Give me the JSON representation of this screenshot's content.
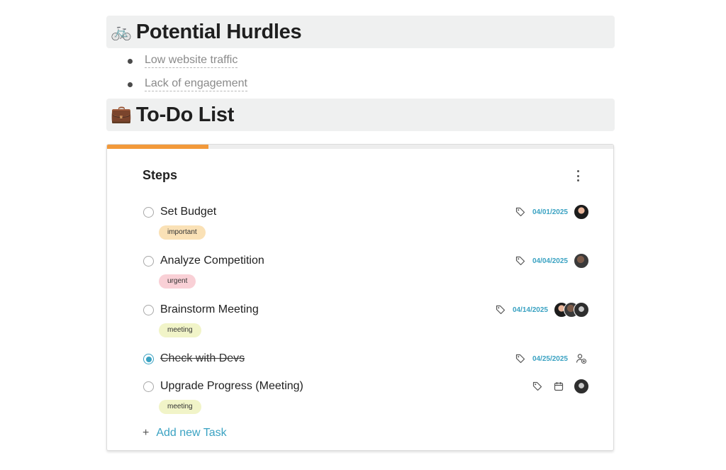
{
  "sections": {
    "hurdles": {
      "emoji": "🚲",
      "title": "Potential Hurdles"
    },
    "todo": {
      "emoji": "💼",
      "title": "To-Do List"
    }
  },
  "bullets": [
    "Low website traffic",
    "Lack of engagement"
  ],
  "card": {
    "title": "Steps",
    "progress": 0.2,
    "colors": {
      "progress": "#f2993a",
      "accent": "#3aa2c2"
    },
    "tasks": [
      {
        "name": "Set Budget",
        "tag": "important",
        "date": "04/01/2025",
        "done": false,
        "assignees": 1
      },
      {
        "name": "Analyze Competition",
        "tag": "urgent",
        "date": "04/04/2025",
        "done": false,
        "assignees": 1
      },
      {
        "name": "Brainstorm Meeting",
        "tag": "meeting",
        "date": "04/14/2025",
        "done": false,
        "assignees": 3
      },
      {
        "name": "Check with Devs",
        "tag": "",
        "date": "04/25/2025",
        "done": true,
        "assignees": 0
      },
      {
        "name": "Upgrade Progress (Meeting)",
        "tag": "meeting",
        "date": "",
        "done": false,
        "assignees": 1
      }
    ],
    "add_task_label": "Add new Task"
  }
}
